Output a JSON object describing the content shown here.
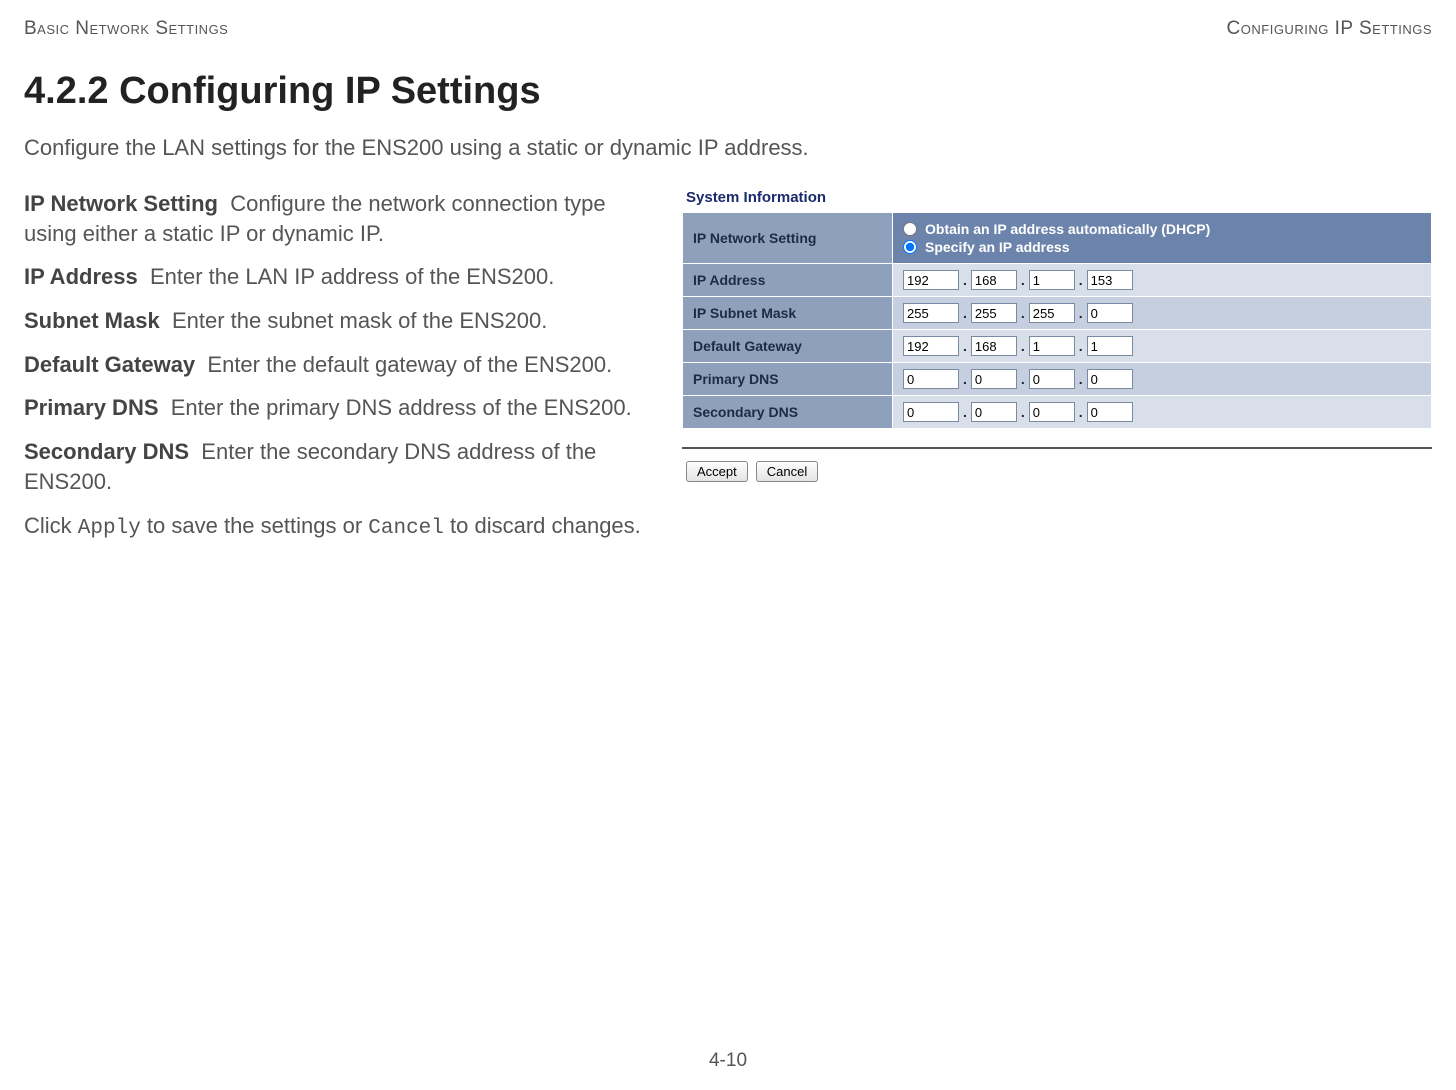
{
  "header": {
    "left": "Basic Network Settings",
    "right": "Configuring IP Settings"
  },
  "section_number": "4.2.2",
  "section_title": "Configuring IP Settings",
  "intro": "Configure the LAN settings for the ENS200 using a static or dynamic IP address.",
  "descriptions": {
    "ip_network_setting": {
      "term": "IP Network Setting",
      "text": "Configure the network connection type using either a static IP or dynamic IP."
    },
    "ip_address": {
      "term": "IP Address",
      "text": "Enter the LAN IP address of the ENS200."
    },
    "subnet_mask": {
      "term": "Subnet Mask",
      "text": "Enter the subnet mask of the ENS200."
    },
    "default_gateway": {
      "term": "Default Gateway",
      "text": "Enter the default gateway of the ENS200."
    },
    "primary_dns": {
      "term": "Primary DNS",
      "text": "Enter the primary DNS address of the ENS200."
    },
    "secondary_dns": {
      "term": "Secondary DNS",
      "text": "Enter the secondary DNS address of the ENS200."
    },
    "apply_line_prefix": "Click ",
    "apply_word": "Apply",
    "apply_line_mid": " to save the settings or ",
    "cancel_word": "Cancel",
    "apply_line_suffix": " to discard changes."
  },
  "panel": {
    "title": "System Information",
    "rows": {
      "ip_network_setting": {
        "label": "IP Network Setting",
        "radio_dhcp": "Obtain an IP address automatically (DHCP)",
        "radio_static": "Specify an IP address",
        "selected": "static"
      },
      "ip_address": {
        "label": "IP Address",
        "octets": [
          "192",
          "168",
          "1",
          "153"
        ]
      },
      "ip_subnet_mask": {
        "label": "IP Subnet Mask",
        "octets": [
          "255",
          "255",
          "255",
          "0"
        ]
      },
      "default_gateway": {
        "label": "Default Gateway",
        "octets": [
          "192",
          "168",
          "1",
          "1"
        ]
      },
      "primary_dns": {
        "label": "Primary DNS",
        "octets": [
          "0",
          "0",
          "0",
          "0"
        ]
      },
      "secondary_dns": {
        "label": "Secondary DNS",
        "octets": [
          "0",
          "0",
          "0",
          "0"
        ]
      }
    },
    "buttons": {
      "accept": "Accept",
      "cancel": "Cancel"
    }
  },
  "footer": "4-10"
}
